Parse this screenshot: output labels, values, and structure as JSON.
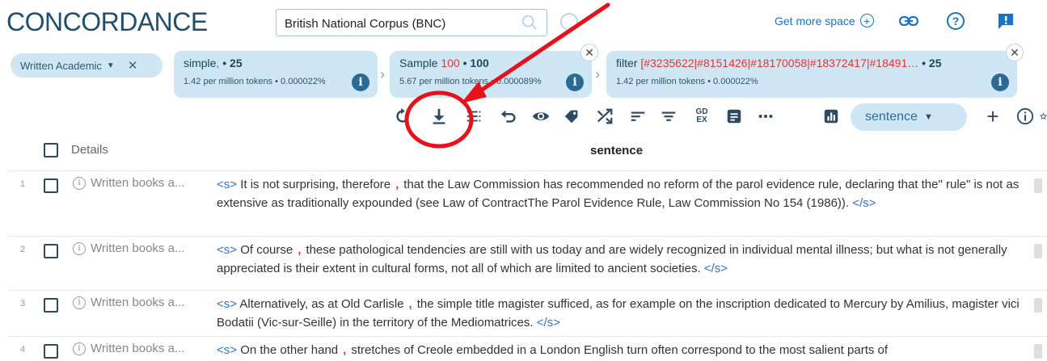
{
  "header": {
    "title": "CONCORDANCE",
    "corpus_value": "British National Corpus (BNC)",
    "get_more_space": "Get more space"
  },
  "filters": {
    "text_type": "Written Academic",
    "chips": [
      {
        "name": "simple",
        "sep": ",",
        "count_prefix": " • ",
        "count": "25",
        "stats": "1.42 per million tokens • 0.000022%"
      },
      {
        "name": "Sample",
        "num": "100",
        "count_prefix": " • ",
        "count": "100",
        "stats": "5.67 per million tokens • 0.000089%"
      },
      {
        "name": "filter",
        "ids": "[#3235622|#8151426|#18170058|#18372417|#18491…",
        "count_prefix": " • ",
        "count": "25",
        "stats": "1.42 per million tokens • 0.000022%"
      }
    ]
  },
  "toolbar": {
    "view_mode": "sentence"
  },
  "table": {
    "col_details": "Details",
    "col_sentence": "sentence",
    "rows": [
      {
        "num": "1",
        "details": "Written books a...",
        "open": "<s>",
        "left": "It is not surprising, therefore",
        "kwic": ",",
        "right": "that the Law Commission has recommended no reform of the parol evidence rule, declaring that the\" rule\" is not as extensive as traditionally expounded (see Law of ContractThe Parol Evidence Rule, Law Commission No 154 (1986)).",
        "close": "</s>"
      },
      {
        "num": "2",
        "details": "Written books a...",
        "open": "<s>",
        "left": "Of course",
        "kwic": ",",
        "right": "these pathological tendencies are still with us today and are widely recognized in individual mental illness; but what is not generally appreciated is their extent in cultural forms, not all of which are limited to ancient societies.",
        "close": "</s>"
      },
      {
        "num": "3",
        "details": "Written books a...",
        "open": "<s>",
        "left": "Alternatively, as at Old Carlisle",
        "kwic": ",",
        "right": "the simple title magister sufficed, as for example on the inscription dedicated to Mercury by Amilius, magister vici Bodatii (Vic-sur-Seille) in the territory of the Mediomatrices.",
        "close": "</s>"
      },
      {
        "num": "4",
        "details": "Written books a...",
        "open": "<s>",
        "left": "On the other hand",
        "kwic": ",",
        "right": "stretches of Creole embedded in a London English turn often correspond to the most salient parts of",
        "close": ""
      }
    ]
  },
  "colors": {
    "accent": "#1a73c8",
    "chip_bg": "#cfe6f4",
    "annotation": "#e8101a"
  }
}
